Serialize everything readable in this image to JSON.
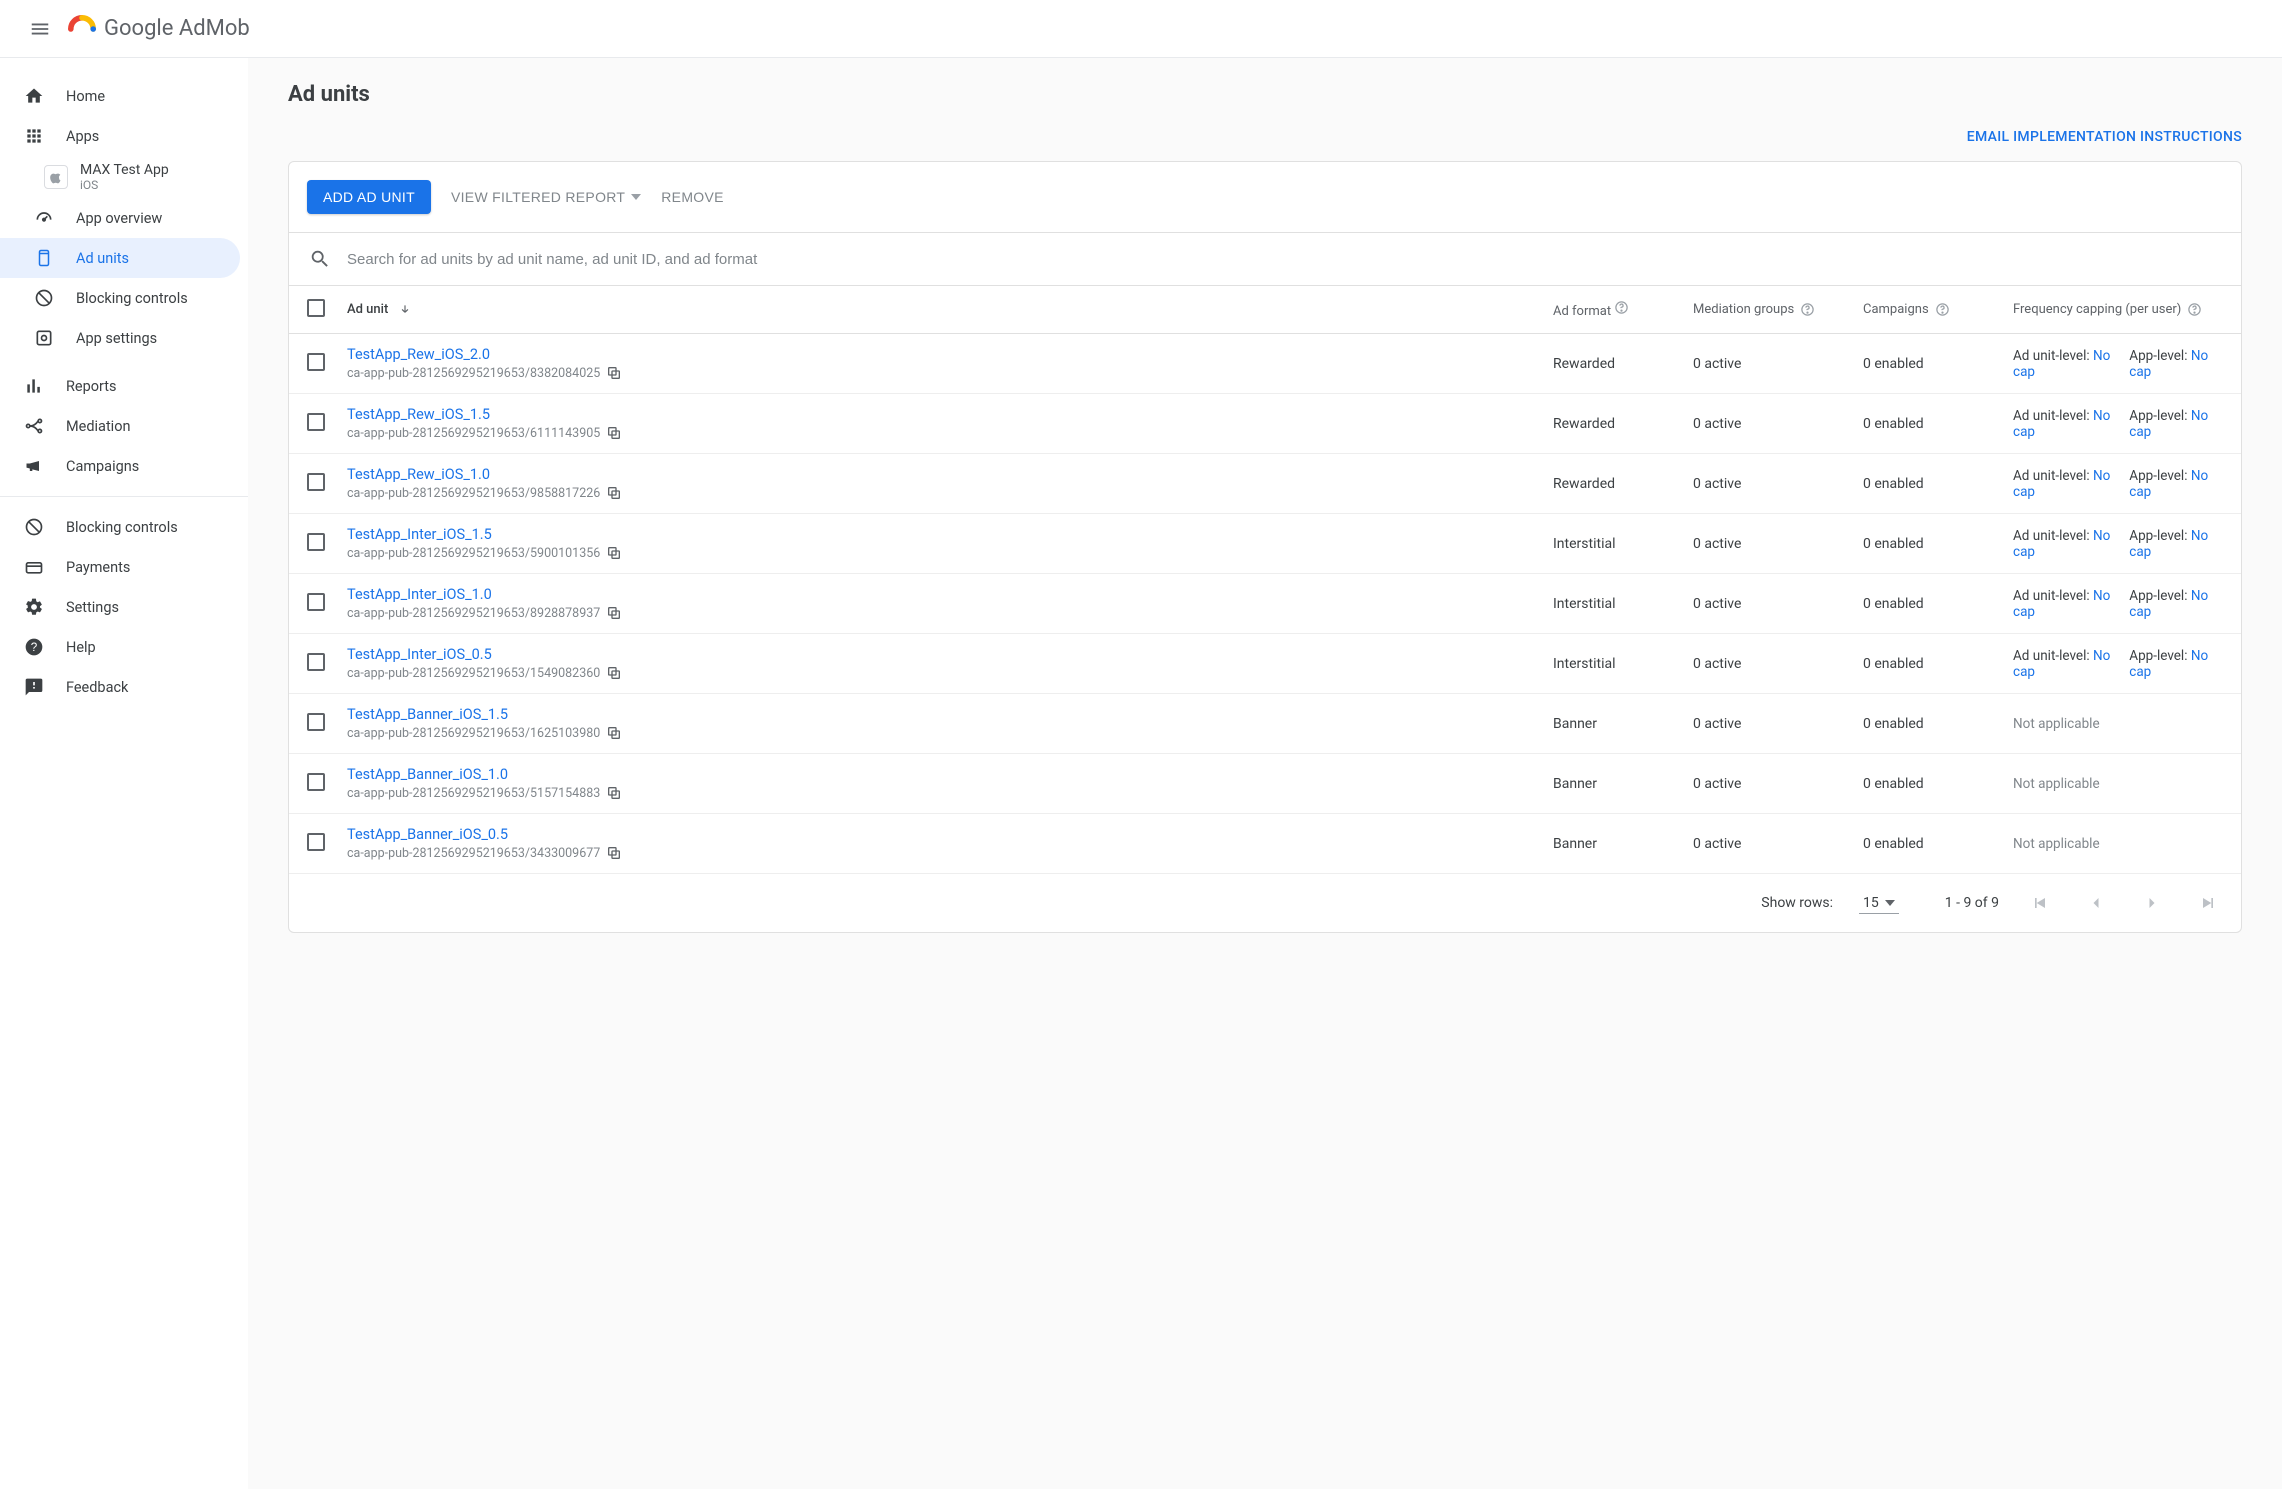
{
  "header": {
    "product_google": "Google",
    "product_name": "AdMob"
  },
  "sidebar": {
    "home": "Home",
    "apps": "Apps",
    "app": {
      "name": "MAX Test App",
      "platform": "iOS"
    },
    "app_overview": "App overview",
    "ad_units": "Ad units",
    "blocking_controls_app": "Blocking controls",
    "app_settings": "App settings",
    "reports": "Reports",
    "mediation": "Mediation",
    "campaigns": "Campaigns",
    "blocking_controls": "Blocking controls",
    "payments": "Payments",
    "settings": "Settings",
    "help": "Help",
    "feedback": "Feedback"
  },
  "page": {
    "title": "Ad units",
    "email_link": "EMAIL IMPLEMENTATION INSTRUCTIONS"
  },
  "toolbar": {
    "add": "ADD AD UNIT",
    "view_filtered": "VIEW FILTERED REPORT",
    "remove": "REMOVE"
  },
  "search": {
    "placeholder": "Search for ad units by ad unit name, ad unit ID, and ad format"
  },
  "columns": {
    "ad_unit": "Ad unit",
    "format": "Ad format",
    "mediation": "Mediation groups",
    "campaigns": "Campaigns",
    "frequency": "Frequency capping (per user)"
  },
  "freq_labels": {
    "unit": "Ad unit-level:",
    "app": "App-level:",
    "nocap": "No cap",
    "na": "Not applicable"
  },
  "rows": [
    {
      "name": "TestApp_Rew_iOS_2.0",
      "id": "ca-app-pub-2812569295219653/8382084025",
      "format": "Rewarded",
      "mediation": "0 active",
      "campaigns": "0 enabled",
      "freq": "cap"
    },
    {
      "name": "TestApp_Rew_iOS_1.5",
      "id": "ca-app-pub-2812569295219653/6111143905",
      "format": "Rewarded",
      "mediation": "0 active",
      "campaigns": "0 enabled",
      "freq": "cap"
    },
    {
      "name": "TestApp_Rew_iOS_1.0",
      "id": "ca-app-pub-2812569295219653/9858817226",
      "format": "Rewarded",
      "mediation": "0 active",
      "campaigns": "0 enabled",
      "freq": "cap"
    },
    {
      "name": "TestApp_Inter_iOS_1.5",
      "id": "ca-app-pub-2812569295219653/5900101356",
      "format": "Interstitial",
      "mediation": "0 active",
      "campaigns": "0 enabled",
      "freq": "cap"
    },
    {
      "name": "TestApp_Inter_iOS_1.0",
      "id": "ca-app-pub-2812569295219653/8928878937",
      "format": "Interstitial",
      "mediation": "0 active",
      "campaigns": "0 enabled",
      "freq": "cap"
    },
    {
      "name": "TestApp_Inter_iOS_0.5",
      "id": "ca-app-pub-2812569295219653/1549082360",
      "format": "Interstitial",
      "mediation": "0 active",
      "campaigns": "0 enabled",
      "freq": "cap"
    },
    {
      "name": "TestApp_Banner_iOS_1.5",
      "id": "ca-app-pub-2812569295219653/1625103980",
      "format": "Banner",
      "mediation": "0 active",
      "campaigns": "0 enabled",
      "freq": "na"
    },
    {
      "name": "TestApp_Banner_iOS_1.0",
      "id": "ca-app-pub-2812569295219653/5157154883",
      "format": "Banner",
      "mediation": "0 active",
      "campaigns": "0 enabled",
      "freq": "na"
    },
    {
      "name": "TestApp_Banner_iOS_0.5",
      "id": "ca-app-pub-2812569295219653/3433009677",
      "format": "Banner",
      "mediation": "0 active",
      "campaigns": "0 enabled",
      "freq": "na"
    }
  ],
  "pager": {
    "show_rows_label": "Show rows:",
    "show_rows_value": "15",
    "range": "1 - 9 of 9"
  }
}
